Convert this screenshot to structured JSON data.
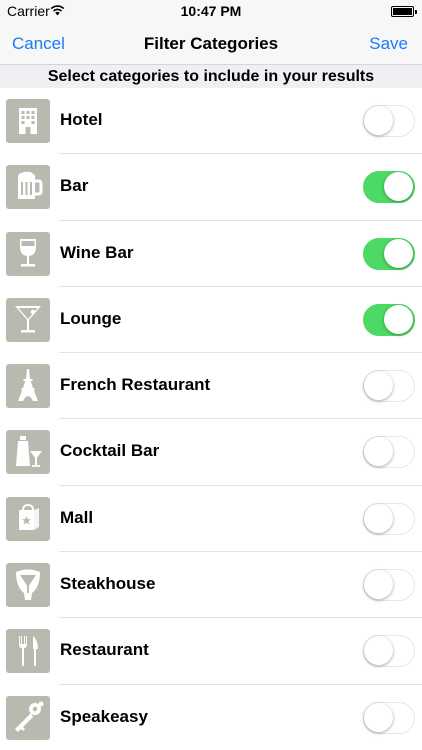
{
  "status_bar": {
    "carrier": "Carrier",
    "time": "10:47 PM",
    "wifi_icon": "wifi-icon",
    "battery_icon": "battery-icon"
  },
  "nav": {
    "cancel": "Cancel",
    "title": "Filter Categories",
    "save": "Save"
  },
  "section_header": "Select categories to include in your results",
  "colors": {
    "accent": "#1a7cf5",
    "toggle_on": "#4cd964",
    "icon_bg": "#b9b9af"
  },
  "categories": [
    {
      "label": "Hotel",
      "icon": "hotel-icon",
      "enabled": false
    },
    {
      "label": "Bar",
      "icon": "beer-mug-icon",
      "enabled": true
    },
    {
      "label": "Wine Bar",
      "icon": "wine-glass-icon",
      "enabled": true
    },
    {
      "label": "Lounge",
      "icon": "martini-glass-icon",
      "enabled": true
    },
    {
      "label": "French Restaurant",
      "icon": "eiffel-tower-icon",
      "enabled": false
    },
    {
      "label": "Cocktail Bar",
      "icon": "cocktail-shaker-icon",
      "enabled": false
    },
    {
      "label": "Mall",
      "icon": "shopping-bag-icon",
      "enabled": false
    },
    {
      "label": "Steakhouse",
      "icon": "t-bone-steak-icon",
      "enabled": false
    },
    {
      "label": "Restaurant",
      "icon": "fork-knife-icon",
      "enabled": false
    },
    {
      "label": "Speakeasy",
      "icon": "key-icon",
      "enabled": false
    }
  ]
}
